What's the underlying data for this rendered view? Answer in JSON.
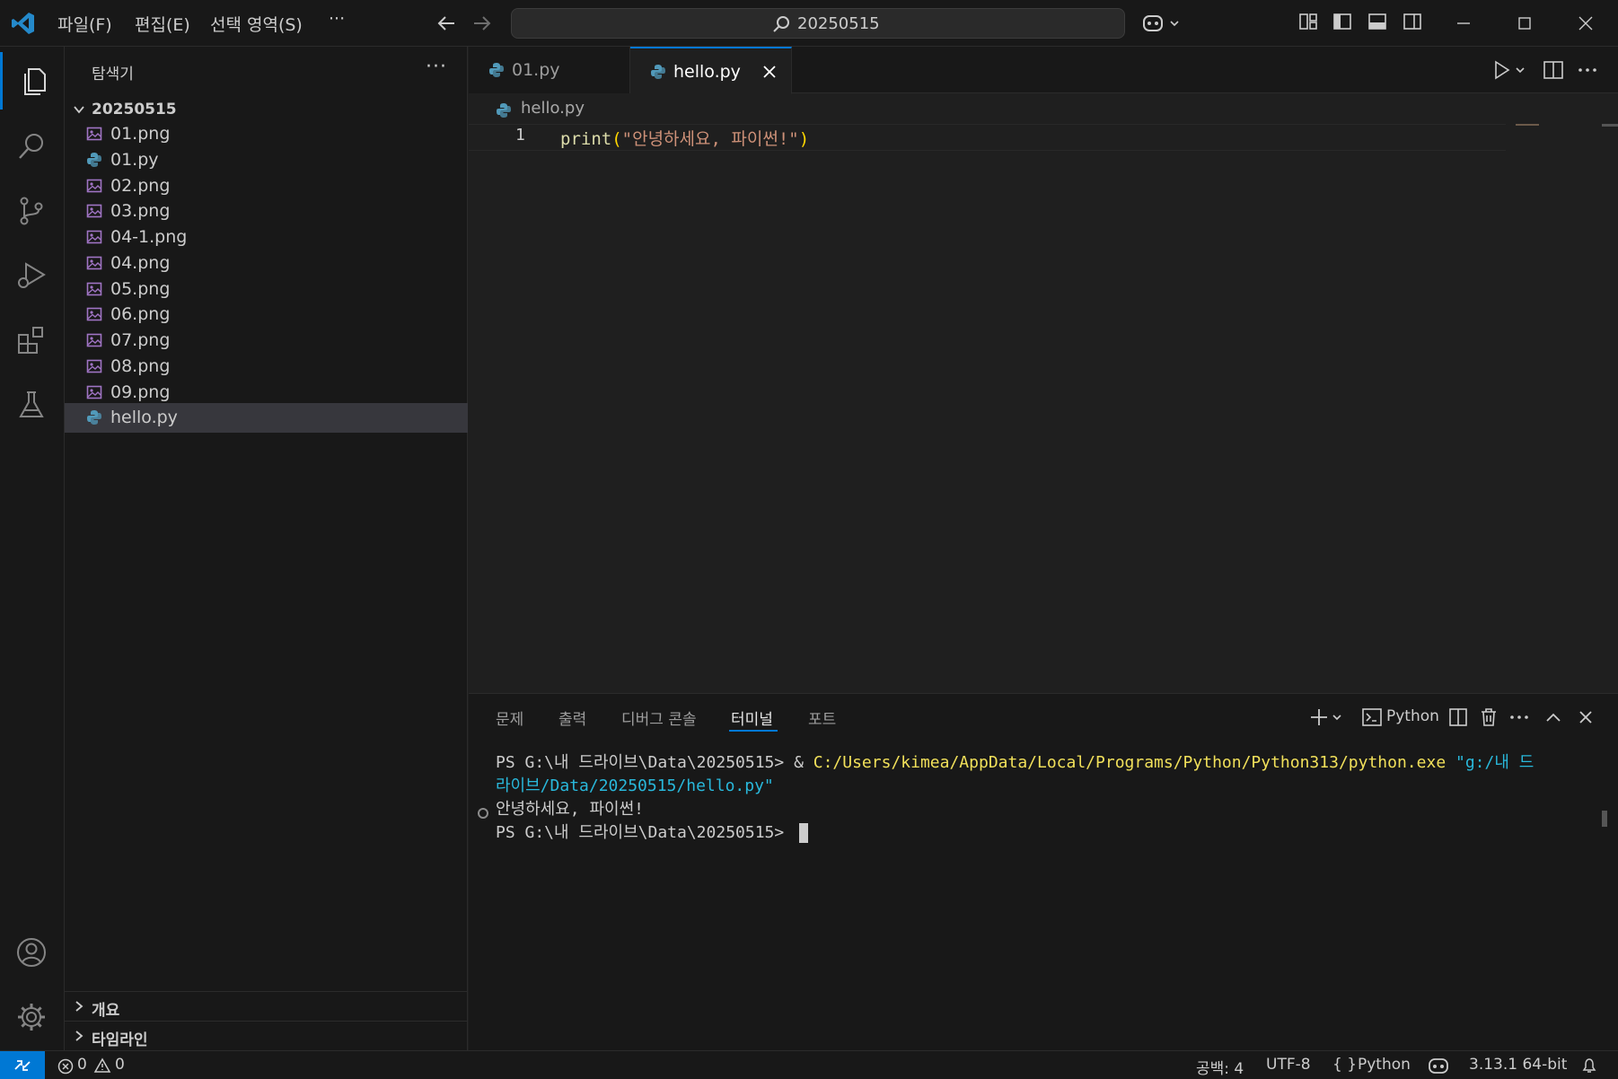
{
  "titlebar": {
    "menus": [
      "파일(F)",
      "편집(E)",
      "선택 영역(S)",
      "···"
    ],
    "search_text": "20250515"
  },
  "sidebar": {
    "title": "탐색기",
    "more": "···",
    "folder": "20250515",
    "files": [
      {
        "name": "01.png",
        "type": "image"
      },
      {
        "name": "01.py",
        "type": "python"
      },
      {
        "name": "02.png",
        "type": "image"
      },
      {
        "name": "03.png",
        "type": "image"
      },
      {
        "name": "04-1.png",
        "type": "image"
      },
      {
        "name": "04.png",
        "type": "image"
      },
      {
        "name": "05.png",
        "type": "image"
      },
      {
        "name": "06.png",
        "type": "image"
      },
      {
        "name": "07.png",
        "type": "image"
      },
      {
        "name": "08.png",
        "type": "image"
      },
      {
        "name": "09.png",
        "type": "image"
      },
      {
        "name": "hello.py",
        "type": "python",
        "selected": true
      }
    ],
    "sections": [
      "개요",
      "타임라인"
    ]
  },
  "editor": {
    "tabs": [
      {
        "name": "01.py",
        "active": false
      },
      {
        "name": "hello.py",
        "active": true
      }
    ],
    "breadcrumb": "hello.py",
    "line_number": "1",
    "code": {
      "fn": "print",
      "open": "(",
      "str": "\"안녕하세요, 파이썬!\"",
      "close": ")"
    }
  },
  "panel": {
    "tabs": [
      "문제",
      "출력",
      "디버그 콘솔",
      "터미널",
      "포트"
    ],
    "active_tab": "터미널",
    "shell": "Python",
    "terminal": {
      "prompt1": "PS G:\\내 드라이브\\Data\\20250515> ",
      "amp": "& ",
      "exe": "C:/Users/kimea/AppData/Local/Programs/Python/Python313/python.exe",
      "arg1": " \"g:/내 드",
      "arg2": "라이브/Data/20250515/hello.py\"",
      "output": "안녕하세요, 파이썬!",
      "prompt2": "PS G:\\내 드라이브\\Data\\20250515> "
    }
  },
  "statusbar": {
    "errors": "0",
    "warnings": "0",
    "indent": "공백: 4",
    "encoding": "UTF-8",
    "language": "Python",
    "interpreter": "3.13.1 64-bit"
  },
  "colors": {
    "accent": "#0078d4",
    "python_icon": "#519aba",
    "image_icon": "#a074c4"
  }
}
